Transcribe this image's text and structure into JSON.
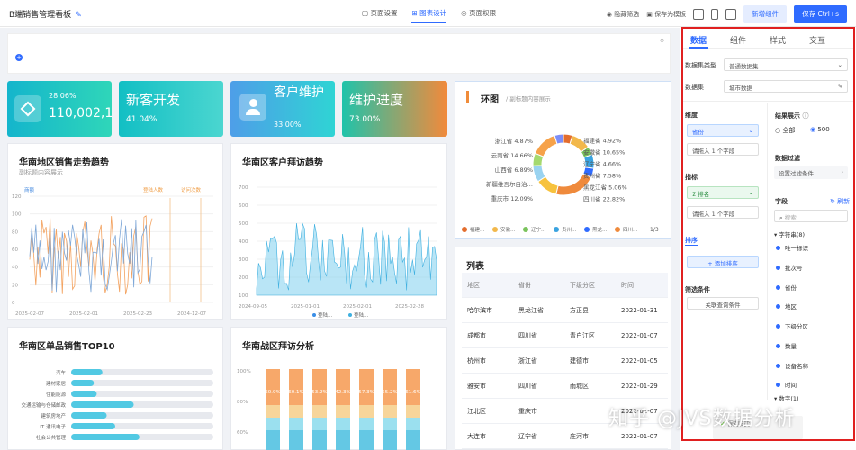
{
  "header": {
    "title": "B端销售管理看板",
    "tabs": [
      "页面设置",
      "图表设计",
      "页面权限"
    ],
    "active_tab": 1,
    "hide_filter": "隐藏筛选",
    "save_template": "保存为模板",
    "add_component": "新增组件",
    "save": "保存 Ctrl+s"
  },
  "kpis": [
    {
      "label": "",
      "value": "110,002,1",
      "pct": "28.06%",
      "colors": [
        "#15b8c9",
        "#2ed3b7"
      ]
    },
    {
      "label": "新客开发",
      "value": "41.04%",
      "colors": [
        "#13c2c2",
        "#36cfc9"
      ]
    },
    {
      "label": "客户维护",
      "value": "33.00%",
      "colors": [
        "#4a9fe8",
        "#2ed3d3"
      ]
    },
    {
      "label": "维护进度",
      "value": "73.00%",
      "colors": [
        "#1cc1a8",
        "#f08c3a"
      ]
    }
  ],
  "charts": {
    "trend": {
      "title": "华南地区销售走势趋势",
      "subtitle": "副标题内容展示",
      "legend_left": "商额",
      "legend_r1": "登陆人数",
      "legend_r2": "访问次数",
      "y_ticks": [
        "120",
        "100",
        "80",
        "60",
        "40",
        "20",
        "0"
      ],
      "x_ticks": [
        "2025-02-07",
        "2025-02-01",
        "2025-02-23",
        "2024-12-07"
      ]
    },
    "visits": {
      "title": "华南区客户拜访趋势",
      "y_ticks": [
        "700",
        "600",
        "500",
        "400",
        "300",
        "200",
        "100"
      ],
      "x_ticks": [
        "2024-09-05",
        "2025-01-01",
        "2025-02-01",
        "2025-02-28"
      ],
      "legend": [
        "登陆…",
        "登陆…"
      ]
    },
    "ring": {
      "title": "环图",
      "subtitle": "副标题内容展示",
      "labels_left": [
        "浙江省 4.87%",
        "云南省 14.66%",
        "山西省 6.89%",
        "新疆维吾尔自治…",
        "重庆市 12.09%"
      ],
      "labels_right": [
        "福建省 4.92%",
        "安徽省 10.65%",
        "辽宁省 4.66%",
        "贵州省 7.58%",
        "黑龙江省 5.06%",
        "四川省 22.82%"
      ],
      "slices": [
        4.92,
        10.65,
        4.66,
        7.58,
        5.06,
        22.82,
        12.09,
        9.0,
        6.89,
        14.66,
        4.87
      ],
      "colors": [
        "#e36d2d",
        "#f2b84b",
        "#7ac35c",
        "#3aa3e0",
        "#2f6bff",
        "#ef8a3c",
        "#f7c23d",
        "#9ad3f0",
        "#a5d96f",
        "#f6a24a",
        "#7c8ef7"
      ],
      "legend": [
        "福建…",
        "安徽…",
        "辽宁…",
        "贵州…",
        "黑龙…",
        "四川…"
      ],
      "page": "1/3"
    },
    "top10": {
      "title": "华南区单品销售TOP10",
      "items": [
        "汽车",
        "建材家居",
        "住能能源",
        "交通运输与仓储邮政",
        "建筑房地产",
        "IT 通讯电子",
        "社会公共管理"
      ],
      "values": [
        0.22,
        0.16,
        0.18,
        0.44,
        0.25,
        0.31,
        0.48
      ]
    },
    "war": {
      "title": "华南战区拜访分析",
      "y_ticks": [
        "100%",
        "80%",
        "60%"
      ],
      "bar_labels": [
        "60.9%",
        "60.1%",
        "53.2%",
        "42.3%",
        "57.3%",
        "55.2%",
        "61.6%"
      ]
    }
  },
  "list": {
    "title": "列表",
    "headers": [
      "地区",
      "省份",
      "下级分区",
      "时间"
    ],
    "rows": [
      [
        "哈尔滨市",
        "黑龙江省",
        "方正县",
        "2022-01-31"
      ],
      [
        "成都市",
        "四川省",
        "青白江区",
        "2022-01-07"
      ],
      [
        "杭州市",
        "浙江省",
        "建德市",
        "2022-01-05"
      ],
      [
        "雅安市",
        "四川省",
        "雨城区",
        "2022-01-29"
      ],
      [
        "江北区",
        "重庆市",
        "",
        "2022-01-07"
      ],
      [
        "大连市",
        "辽宁省",
        "庄河市",
        "2022-01-07"
      ]
    ]
  },
  "panel": {
    "tabs": [
      "数据",
      "组件",
      "样式",
      "交互"
    ],
    "dataset_type_label": "数据集类型",
    "dataset_type": "普通数据集",
    "dataset_label": "数据集",
    "dataset": "城市数据",
    "dim_label": "维度",
    "dim_chip": "省份",
    "dim_placeholder": "请拖入 1 个字段",
    "metric_label": "指标",
    "metric_chip": "Σ 排名",
    "metric_placeholder": "请拖入 1 个字段",
    "sort_label": "排序",
    "add_sort": "+ 添加排序",
    "filter_label": "筛选条件",
    "filter_button": "关联查询条件",
    "result_label": "结果展示",
    "opt_all": "全部",
    "opt_500": "500",
    "data_filter_label": "数据过滤",
    "data_filter_btn": "设置过滤条件",
    "fields_label": "字段",
    "refresh": "刷新",
    "search": "搜索",
    "group_str": "字符串(8)",
    "fields": [
      "唯一标识",
      "批次号",
      "省份",
      "地区",
      "下级分区",
      "数量",
      "设备名称",
      "时间"
    ],
    "group_num": "数字(1)"
  },
  "watermark": "知乎 @JVS数据分析",
  "toast": "保存成功"
}
